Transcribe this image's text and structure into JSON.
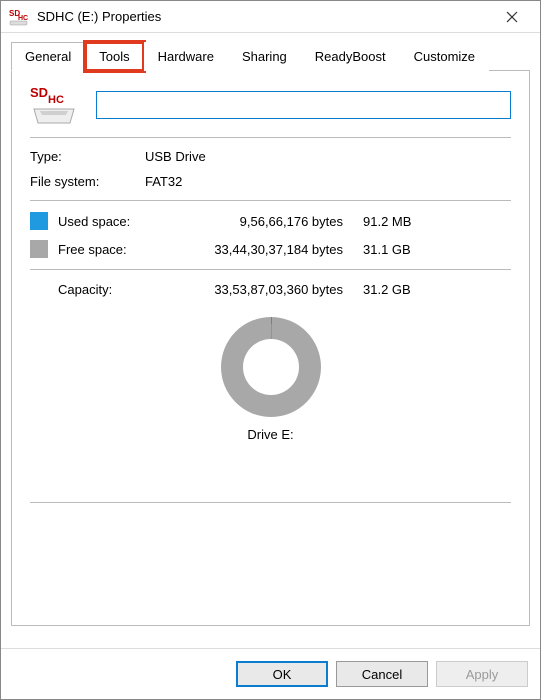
{
  "window": {
    "title": "SDHC (E:) Properties"
  },
  "tabs": {
    "items": [
      {
        "label": "General"
      },
      {
        "label": "Tools"
      },
      {
        "label": "Hardware"
      },
      {
        "label": "Sharing"
      },
      {
        "label": "ReadyBoost"
      },
      {
        "label": "Customize"
      }
    ]
  },
  "general": {
    "drive_label_value": "",
    "type_label": "Type:",
    "type_value": "USB Drive",
    "fs_label": "File system:",
    "fs_value": "FAT32",
    "used_label": "Used space:",
    "used_bytes": "9,56,66,176 bytes",
    "used_human": "91.2 MB",
    "free_label": "Free space:",
    "free_bytes": "33,44,30,37,184 bytes",
    "free_human": "31.1 GB",
    "capacity_label": "Capacity:",
    "capacity_bytes": "33,53,87,03,360 bytes",
    "capacity_human": "31.2 GB",
    "drive_caption": "Drive E:"
  },
  "buttons": {
    "ok": "OK",
    "cancel": "Cancel",
    "apply": "Apply"
  },
  "icons": {
    "sd_text_s": "SD",
    "sd_text_hc": "HC"
  },
  "chart_data": {
    "type": "pie",
    "title": "Drive E:",
    "series": [
      {
        "name": "Used space",
        "value_bytes": 95666176,
        "value_human": "91.2 MB",
        "color": "#1f9ae0"
      },
      {
        "name": "Free space",
        "value_bytes": 33443037184,
        "value_human": "31.1 GB",
        "color": "#a8a8a8"
      }
    ],
    "total": {
      "name": "Capacity",
      "value_bytes": 33538703360,
      "value_human": "31.2 GB"
    }
  }
}
